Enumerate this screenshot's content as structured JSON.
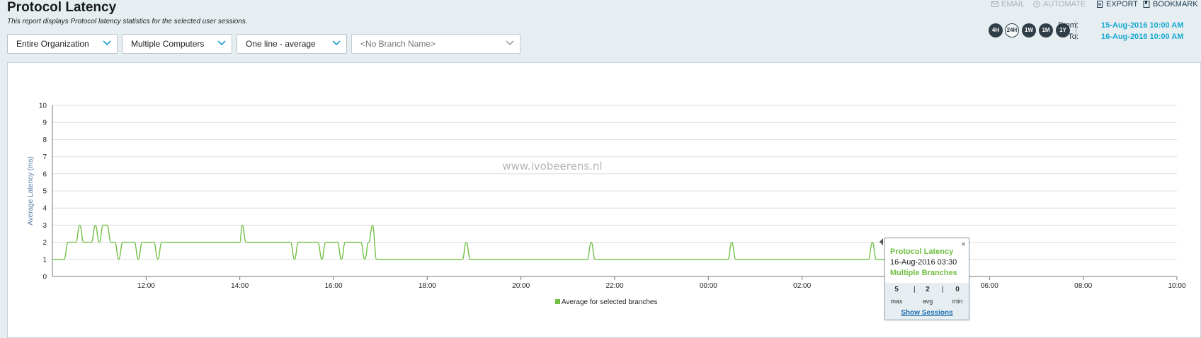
{
  "header": {
    "title": "Protocol Latency",
    "subtitle": "This report displays Protocol latency statistics for the selected user sessions."
  },
  "filters": {
    "scope": "Entire Organization",
    "computers": "Multiple Computers",
    "mode": "One line - average",
    "branch": "<No Branch Name>"
  },
  "actions": {
    "email": "EMAIL",
    "automate": "AUTOMATE",
    "export": "EXPORT",
    "bookmark": "BOOKMARK"
  },
  "periods": [
    "4H",
    "24H",
    "1W",
    "1M",
    "1Y"
  ],
  "active_period": "24H",
  "range": {
    "from_label": "From:",
    "from_value": "15-Aug-2016 10:00 AM",
    "to_label": "To:",
    "to_value": "16-Aug-2016 10:00 AM"
  },
  "watermark": "www.ivobeerens.nl",
  "chart_data": {
    "type": "line",
    "title": "",
    "xlabel": "",
    "ylabel": "Average Latency (ms)",
    "ylim": [
      0,
      10
    ],
    "yticks": [
      0,
      1,
      2,
      3,
      4,
      5,
      6,
      7,
      8,
      9,
      10
    ],
    "xlim": [
      "10:00",
      "10:00"
    ],
    "xticks": [
      "12:00",
      "14:00",
      "16:00",
      "18:00",
      "20:00",
      "22:00",
      "00:00",
      "02:00",
      "04:00",
      "06:00",
      "08:00",
      "10:00"
    ],
    "grid": true,
    "legend_position": "bottom-center",
    "color": "#72bf44",
    "series": [
      {
        "name": "Average for selected branches",
        "points": [
          [
            "10:00",
            1
          ],
          [
            "10:15",
            1
          ],
          [
            "10:20",
            2
          ],
          [
            "10:30",
            2
          ],
          [
            "10:35",
            3
          ],
          [
            "10:40",
            2
          ],
          [
            "10:45",
            2
          ],
          [
            "10:50",
            2
          ],
          [
            "10:55",
            3
          ],
          [
            "11:00",
            2
          ],
          [
            "11:05",
            3
          ],
          [
            "11:10",
            3
          ],
          [
            "11:15",
            2
          ],
          [
            "11:20",
            2
          ],
          [
            "11:25",
            1
          ],
          [
            "11:30",
            2
          ],
          [
            "11:45",
            2
          ],
          [
            "11:50",
            1
          ],
          [
            "11:55",
            2
          ],
          [
            "12:10",
            2
          ],
          [
            "12:15",
            1
          ],
          [
            "12:20",
            2
          ],
          [
            "14:00",
            2
          ],
          [
            "14:03",
            3
          ],
          [
            "14:08",
            2
          ],
          [
            "15:05",
            2
          ],
          [
            "15:10",
            1
          ],
          [
            "15:15",
            2
          ],
          [
            "15:40",
            2
          ],
          [
            "15:45",
            1
          ],
          [
            "15:50",
            2
          ],
          [
            "16:05",
            2
          ],
          [
            "16:10",
            1
          ],
          [
            "16:15",
            2
          ],
          [
            "16:35",
            2
          ],
          [
            "16:40",
            1
          ],
          [
            "16:45",
            2
          ],
          [
            "16:50",
            3
          ],
          [
            "16:55",
            1
          ],
          [
            "18:45",
            1
          ],
          [
            "18:50",
            2
          ],
          [
            "18:55",
            1
          ],
          [
            "21:25",
            1
          ],
          [
            "21:30",
            2
          ],
          [
            "21:35",
            1
          ],
          [
            "00:25",
            1
          ],
          [
            "00:30",
            2
          ],
          [
            "00:35",
            1
          ],
          [
            "03:25",
            1
          ],
          [
            "03:30",
            2
          ],
          [
            "03:35",
            1
          ],
          [
            "04:00",
            1
          ]
        ]
      }
    ]
  },
  "tooltip": {
    "series": "Protocol Latency",
    "timestamp": "16-Aug-2016 03:30",
    "group": "Multiple Branches",
    "max": "5",
    "avg": "2",
    "min": "0",
    "max_label": "max",
    "avg_label": "avg",
    "min_label": "min",
    "link": "Show Sessions",
    "close": "×"
  }
}
